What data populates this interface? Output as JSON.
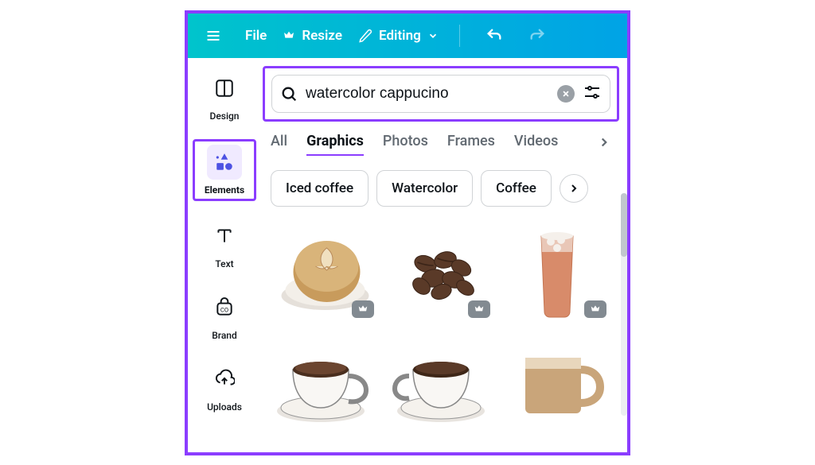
{
  "topbar": {
    "file": "File",
    "resize": "Resize",
    "editing": "Editing"
  },
  "sidebar": {
    "items": [
      {
        "label": "Design"
      },
      {
        "label": "Elements"
      },
      {
        "label": "Text"
      },
      {
        "label": "Brand"
      },
      {
        "label": "Uploads"
      }
    ]
  },
  "search": {
    "value": "watercolor cappucino"
  },
  "tabs": {
    "items": [
      "All",
      "Graphics",
      "Photos",
      "Frames",
      "Videos"
    ],
    "active": 1
  },
  "chips": [
    "Iced coffee",
    "Watercolor",
    "Coffee"
  ],
  "results": [
    {
      "name": "latte-art-cup",
      "premium": true
    },
    {
      "name": "coffee-beans",
      "premium": true
    },
    {
      "name": "iced-coffee-glass",
      "premium": true
    },
    {
      "name": "espresso-cup-1",
      "premium": false
    },
    {
      "name": "espresso-cup-2",
      "premium": false
    },
    {
      "name": "flat-coffee-mug",
      "premium": false
    }
  ]
}
